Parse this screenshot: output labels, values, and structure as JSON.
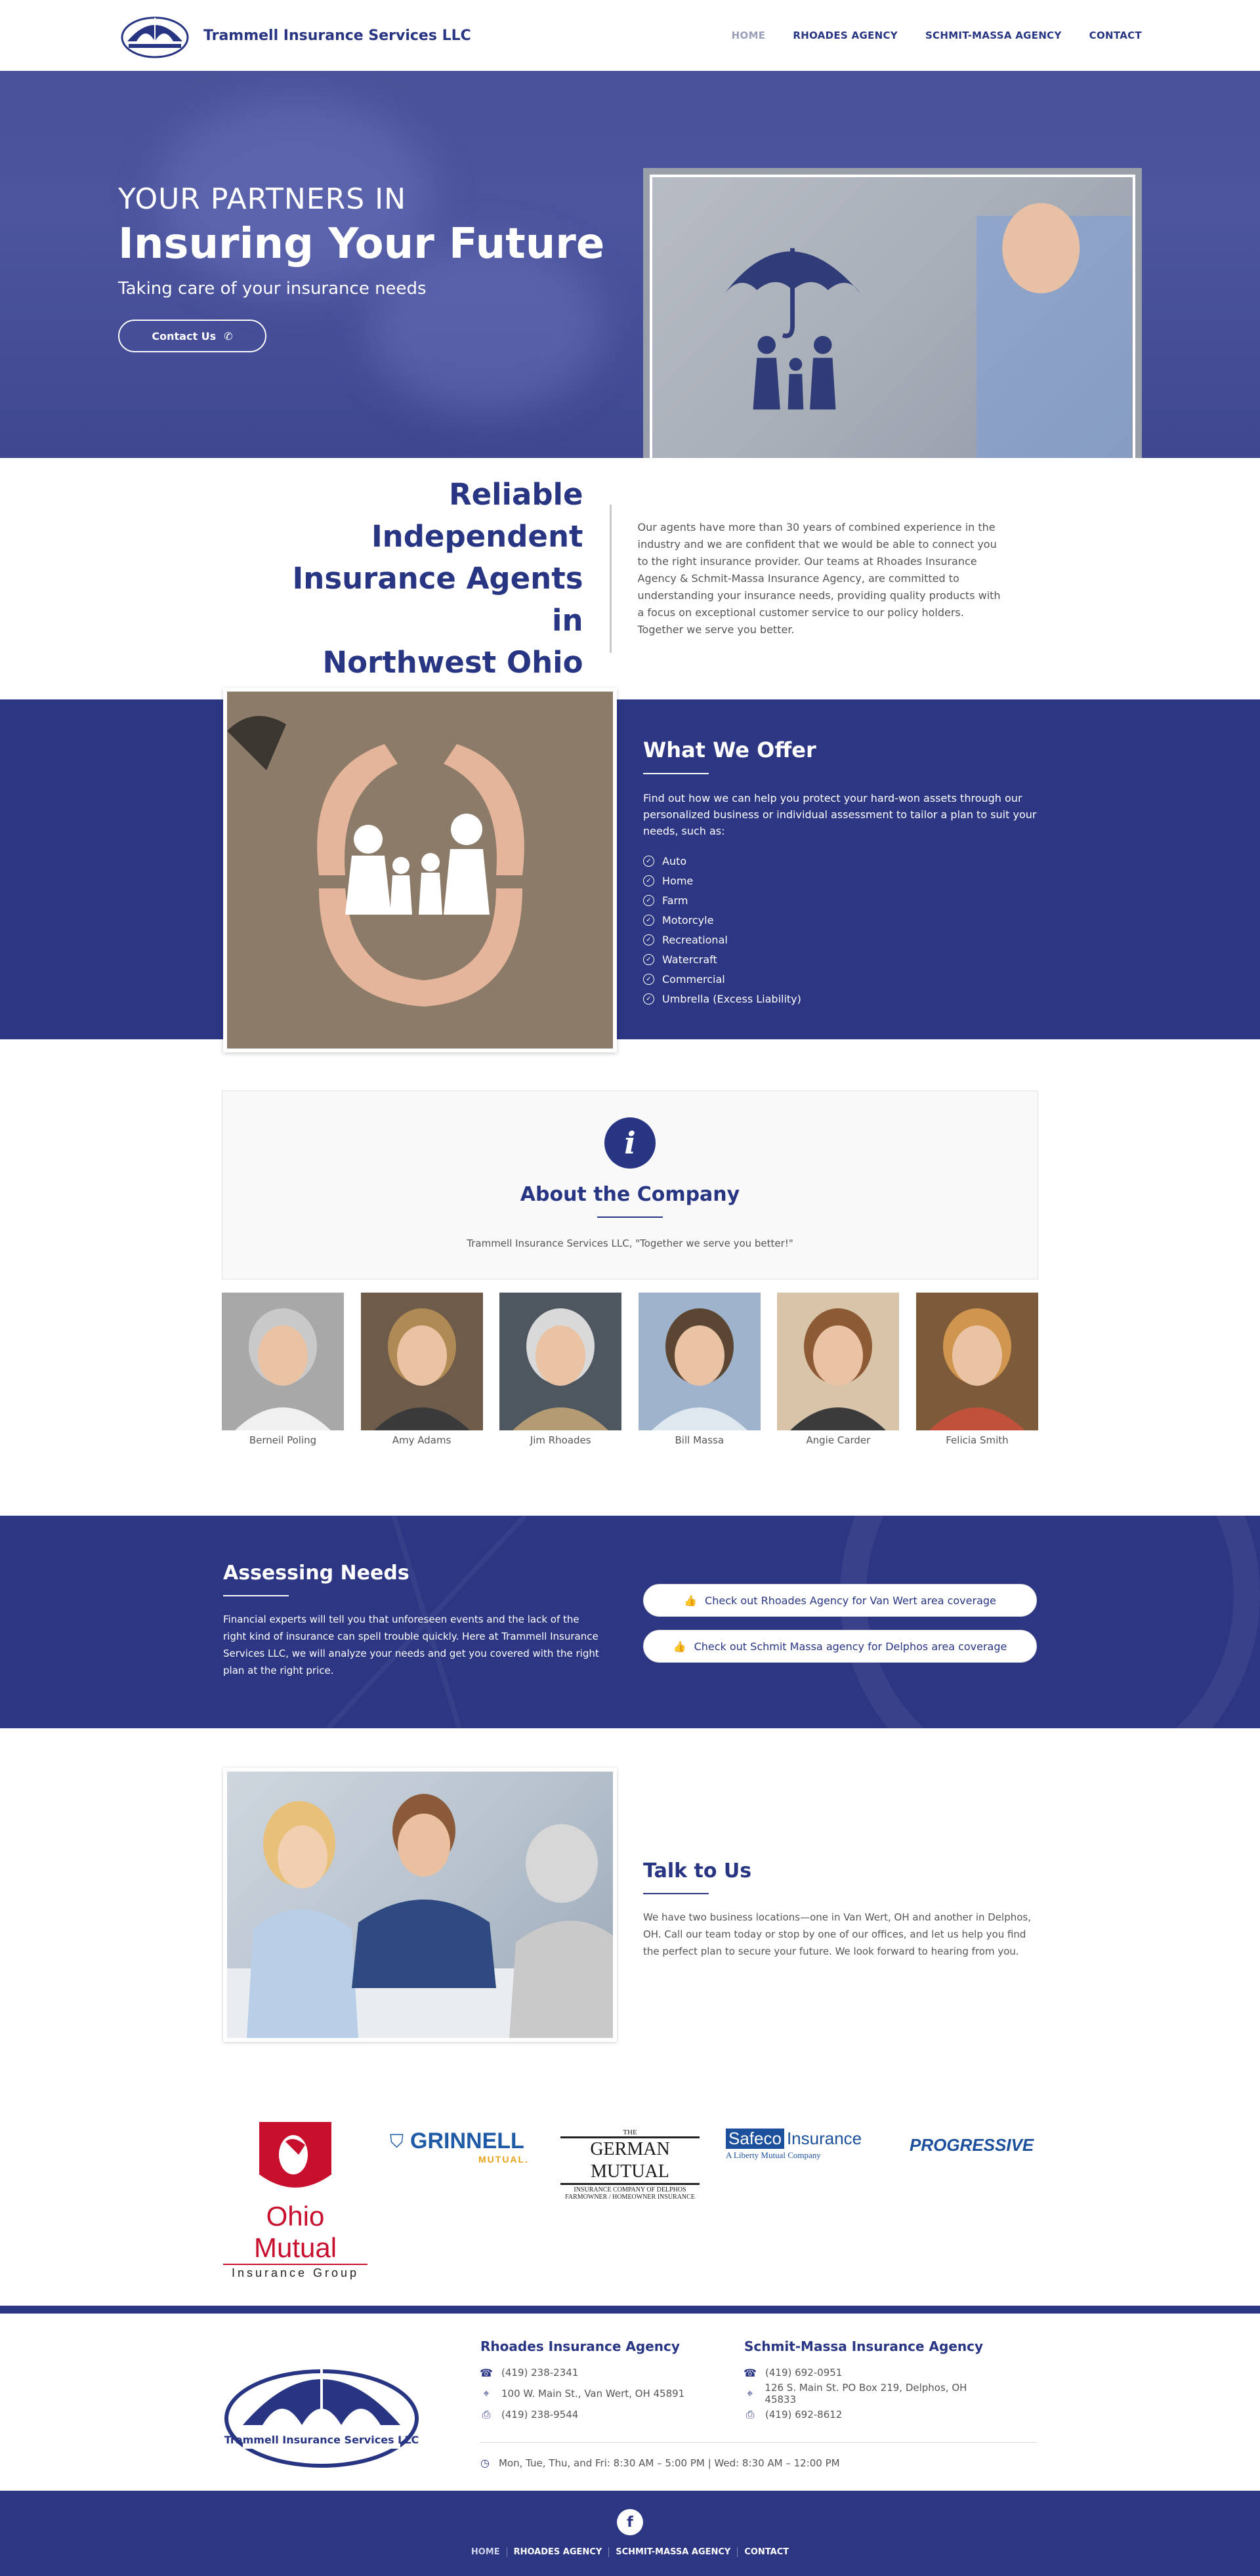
{
  "header": {
    "brand_name": "Trammell Insurance Services LLC",
    "nav": [
      "HOME",
      "RHOADES AGENCY",
      "SCHMIT-MASSA AGENCY",
      "CONTACT"
    ]
  },
  "hero": {
    "line1": "YOUR PARTNERS IN",
    "headline": "Insuring Your Future",
    "tagline": "Taking care of your insurance needs",
    "button": "Contact Us"
  },
  "intro": {
    "heading_lines": [
      "Reliable Independent",
      "Insurance Agents in",
      "Northwest Ohio"
    ],
    "body": "Our agents have more than 30 years of combined experience in the industry and we are confident that we would be able to connect you to the right insurance provider. Our teams at Rhoades Insurance Agency & Schmit-Massa Insurance Agency, are committed to understanding your insurance needs, providing quality products with a focus on exceptional customer service to our policy holders. Together we serve you better."
  },
  "offer": {
    "title": "What We Offer",
    "description": "Find out how we can help you protect your hard-won assets through our personalized business or individual assessment to tailor a plan to suit your needs, such as:",
    "items": [
      "Auto",
      "Home",
      "Farm",
      "Motorcyle",
      "Recreational",
      "Watercraft",
      "Commercial",
      "Umbrella (Excess Liability)"
    ]
  },
  "about": {
    "icon_label": "i",
    "title": "About the Company",
    "tagline": "Trammell Insurance Services LLC, \"Together we serve you better!\""
  },
  "team": [
    {
      "name": "Berneil Poling",
      "hair": "#c9c9c9",
      "bg": "#a8a8a8",
      "shirt": "#f0f0f0"
    },
    {
      "name": "Amy Adams",
      "hair": "#b08a55",
      "bg": "#6e5b4a",
      "shirt": "#3a3a3a"
    },
    {
      "name": "Jim Rhoades",
      "hair": "#d9d9d9",
      "bg": "#4e5660",
      "shirt": "#b49b74"
    },
    {
      "name": "Bill Massa",
      "hair": "#5a4632",
      "bg": "#9fb4cc",
      "shirt": "#dfe7ef"
    },
    {
      "name": "Angie Carder",
      "hair": "#8c5a35",
      "bg": "#d8c4a8",
      "shirt": "#3b3b3b"
    },
    {
      "name": "Felicia Smith",
      "hair": "#d0954e",
      "bg": "#7c5a3a",
      "shirt": "#c0523b"
    }
  ],
  "assess": {
    "title": "Assessing Needs",
    "description": "Financial experts will tell you that unforeseen events and the lack of the right kind of insurance can spell trouble quickly. Here at Trammell Insurance Services LLC, we will analyze your needs and get you covered with the right plan at the right price.",
    "buttons": [
      "Check out Rhoades Agency for Van Wert area coverage",
      "Check out Schmit Massa agency for Delphos area coverage"
    ]
  },
  "talk": {
    "title": "Talk to Us",
    "description": "We have two business locations—one in Van Wert, OH and another in Delphos, OH. Call our team today or stop by one of our offices, and let us help you find the perfect plan to secure your future. We look forward to hearing from you."
  },
  "partners": {
    "ohio_mutual": "Ohio Mutual",
    "ohio_mutual_sub": "Insurance Group",
    "grinnell": "GRINNELL",
    "grinnell_sub": "MUTUAL.",
    "german_the": "THE",
    "german_name": "GERMAN MUTUAL",
    "german_sub": "INSURANCE COMPANY OF DELPHOS",
    "german_sub2": "FARMOWNER / HOMEOWNER INSURANCE",
    "safeco": "Safeco",
    "safeco_ins": "Insurance",
    "safeco_sub": "A Liberty Mutual Company",
    "progressive": "PROGRESSIVE"
  },
  "footer": {
    "logo_text": "Trammell Insurance Services LLC",
    "agencies": [
      {
        "name": "Rhoades Insurance Agency",
        "phone": "(419) 238-2341",
        "address": "100 W. Main St., Van Wert, OH 45891",
        "fax": "(419) 238-9544"
      },
      {
        "name": "Schmit-Massa Insurance Agency",
        "phone": "(419) 692-0951",
        "address": "126 S. Main St. PO Box 219, Delphos, OH 45833",
        "fax": "(419) 692-8612"
      }
    ],
    "hours": "Mon, Tue, Thu, and Fri: 8:30 AM – 5:00 PM | Wed: 8:30 AM – 12:00 PM",
    "facebook": "f",
    "nav": [
      "HOME",
      "RHOADES AGENCY",
      "SCHMIT-MASSA AGENCY",
      "CONTACT"
    ]
  },
  "colors": {
    "navy": "#283583",
    "band": "#2c3682",
    "hero": "#4b549d"
  }
}
